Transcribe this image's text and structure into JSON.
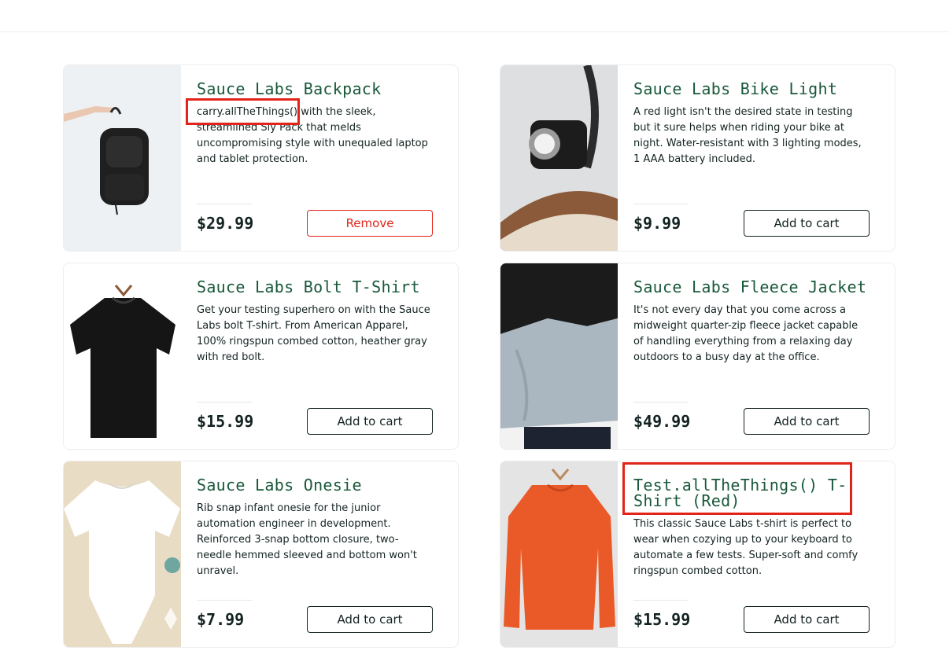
{
  "products": [
    {
      "name": "Sauce Labs Backpack",
      "desc": "carry.allTheThings() with the sleek, streamlined Sly Pack that melds uncompromising style with unequaled laptop and tablet protection.",
      "price": "$29.99",
      "button": "Remove",
      "image": "backpack"
    },
    {
      "name": "Sauce Labs Bike Light",
      "desc": "A red light isn't the desired state in testing but it sure helps when riding your bike at night. Water-resistant with 3 lighting modes, 1 AAA battery included.",
      "price": "$9.99",
      "button": "Add to cart",
      "image": "bike-light"
    },
    {
      "name": "Sauce Labs Bolt T-Shirt",
      "desc": "Get your testing superhero on with the Sauce Labs bolt T-shirt. From American Apparel, 100% ringspun combed cotton, heather gray with red bolt.",
      "price": "$15.99",
      "button": "Add to cart",
      "image": "black-tshirt"
    },
    {
      "name": "Sauce Labs Fleece Jacket",
      "desc": "It's not every day that you come across a midweight quarter-zip fleece jacket capable of handling everything from a relaxing day outdoors to a busy day at the office.",
      "price": "$49.99",
      "button": "Add to cart",
      "image": "fleece-jacket"
    },
    {
      "name": "Sauce Labs Onesie",
      "desc": "Rib snap infant onesie for the junior automation engineer in development. Reinforced 3-snap bottom closure, two-needle hemmed sleeved and bottom won't unravel.",
      "price": "$7.99",
      "button": "Add to cart",
      "image": "onesie"
    },
    {
      "name": "Test.allTheThings() T-Shirt (Red)",
      "desc": "This classic Sauce Labs t-shirt is perfect to wear when cozying up to your keyboard to automate a few tests. Super-soft and comfy ringspun combed cotton.",
      "price": "$15.99",
      "button": "Add to cart",
      "image": "red-sweatshirt"
    }
  ],
  "colors": {
    "title_green": "#18583a",
    "remove_red": "#e2231a",
    "highlight_red": "#e2231a",
    "text": "#132322"
  }
}
